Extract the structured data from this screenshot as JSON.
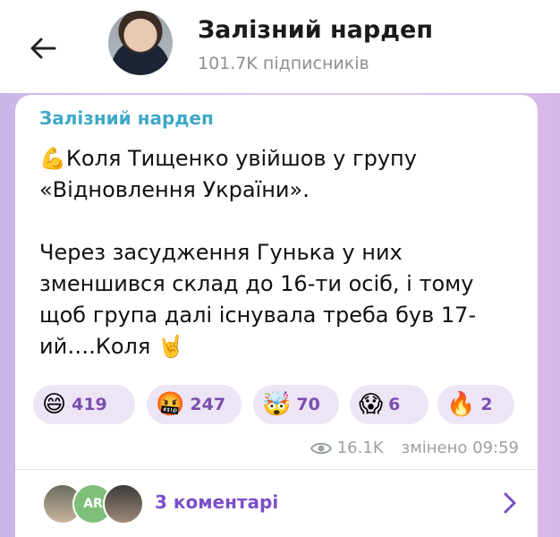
{
  "header": {
    "back_icon": "arrow-left-icon",
    "title": "Залізний нардеп",
    "subscribers": "101.7K підписників"
  },
  "post": {
    "author": "Залізний нардеп",
    "lines": [
      "💪Коля Тищенко увійшов у групу «Відновлення України».",
      "Через засудження Гунька у них зменшився склад до 16-ти осіб, і тому щоб група далі існувала треба був 17-ий….Коля 🤘"
    ],
    "reactions": [
      {
        "emoji": "😄",
        "count": "419"
      },
      {
        "emoji": "🤬",
        "count": "247"
      },
      {
        "emoji": "🤯",
        "count": "70"
      },
      {
        "emoji": "😱",
        "count": "6"
      },
      {
        "emoji": "🔥",
        "count": "2"
      }
    ],
    "views": "16.1K",
    "edited": "змінено 09:59"
  },
  "comments": {
    "avatar_initials": "AR",
    "label": "3 коментарі"
  },
  "colors": {
    "accent": "#7a4fc8",
    "author": "#3fa8c8",
    "reaction_bg": "#ede4f5"
  }
}
